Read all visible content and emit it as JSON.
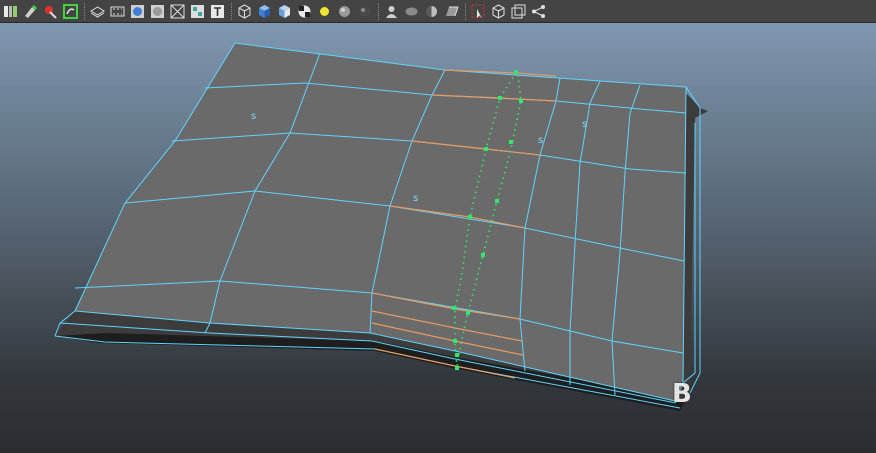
{
  "toolbar": {
    "groups": [
      [
        "channel-box-icon",
        "paint-icon",
        "sculpt-icon",
        "lasso-icon"
      ],
      [
        "wireframe-icon",
        "filmstrip-icon",
        "smooth-shade-icon",
        "flat-shade-icon",
        "xray-icon",
        "texture-grid-icon",
        "text-icon"
      ],
      [
        "cube-wire-icon",
        "cube-shaded-icon",
        "cube-textured-icon",
        "checker-icon",
        "light-yellow-icon",
        "sphere-gray-icon",
        "sphere-dark-icon"
      ],
      [
        "camera-person-icon",
        "shadow-icon",
        "half-sphere-icon",
        "ambient-occlusion-icon"
      ],
      [
        "isolate-select-icon",
        "grid-cube-icon",
        "frame-icon",
        "share-icon"
      ]
    ],
    "accent_green": "#3dd63d",
    "accent_red": "#e03030"
  },
  "viewport": {
    "view_letter": "B",
    "component_marks": [
      "s",
      "s",
      "s",
      "s"
    ],
    "mesh_color": "#6a6a6a",
    "wire_color": "#5fd4ff",
    "selected_edge_color": "#e79a62",
    "vertex_color": "#31e86b"
  }
}
